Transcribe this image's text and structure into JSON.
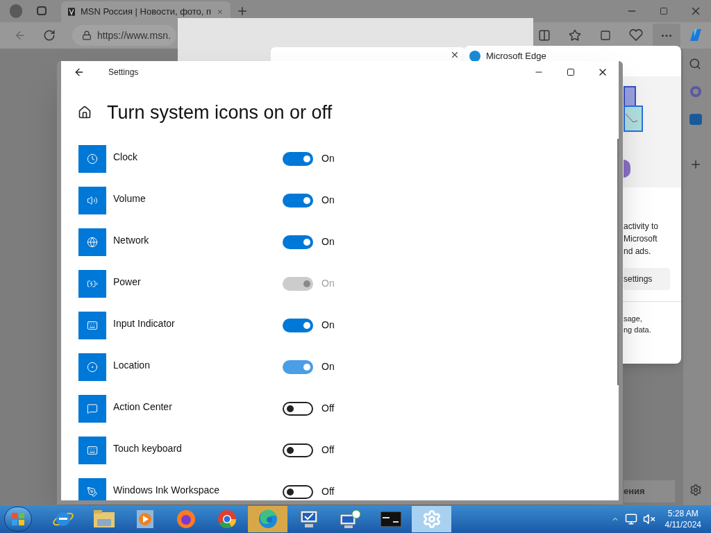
{
  "browser": {
    "tab_title": "MSN Россия | Новости, фото, п",
    "url": "https://www.msn.",
    "edge_panel": {
      "title": "Microsoft Edge",
      "paragraph_1": [
        "activity to",
        "Microsoft",
        "nd ads."
      ],
      "button": "settings",
      "paragraph_2": [
        "sage,",
        "ng data."
      ]
    },
    "dropdown": "ения"
  },
  "settings": {
    "window_title": "Settings",
    "heading": "Turn system icons on or off",
    "items": [
      {
        "label": "Clock",
        "on": true,
        "disabled": false,
        "state_text": "On"
      },
      {
        "label": "Volume",
        "on": true,
        "disabled": false,
        "state_text": "On"
      },
      {
        "label": "Network",
        "on": true,
        "disabled": false,
        "state_text": "On"
      },
      {
        "label": "Power",
        "on": true,
        "disabled": true,
        "state_text": "On"
      },
      {
        "label": "Input Indicator",
        "on": true,
        "disabled": false,
        "state_text": "On"
      },
      {
        "label": "Location",
        "on": true,
        "disabled": false,
        "hovered": true,
        "state_text": "On"
      },
      {
        "label": "Action Center",
        "on": false,
        "disabled": false,
        "state_text": "Off"
      },
      {
        "label": "Touch keyboard",
        "on": false,
        "disabled": false,
        "state_text": "Off"
      },
      {
        "label": "Windows Ink Workspace",
        "on": false,
        "disabled": false,
        "state_text": "Off"
      }
    ]
  },
  "taskbar": {
    "apps": [
      {
        "kind": "ie",
        "selected": false
      },
      {
        "kind": "folder",
        "selected": false
      },
      {
        "kind": "media",
        "selected": false
      },
      {
        "kind": "firefox",
        "selected": false
      },
      {
        "kind": "chrome",
        "selected": false
      },
      {
        "kind": "edge",
        "selected": true
      },
      {
        "kind": "monitor",
        "selected": false
      },
      {
        "kind": "monitor-clock",
        "selected": false
      },
      {
        "kind": "console",
        "selected": false
      },
      {
        "kind": "gear",
        "selected": true
      }
    ],
    "time": "5:28 AM",
    "date": "4/11/2024"
  }
}
